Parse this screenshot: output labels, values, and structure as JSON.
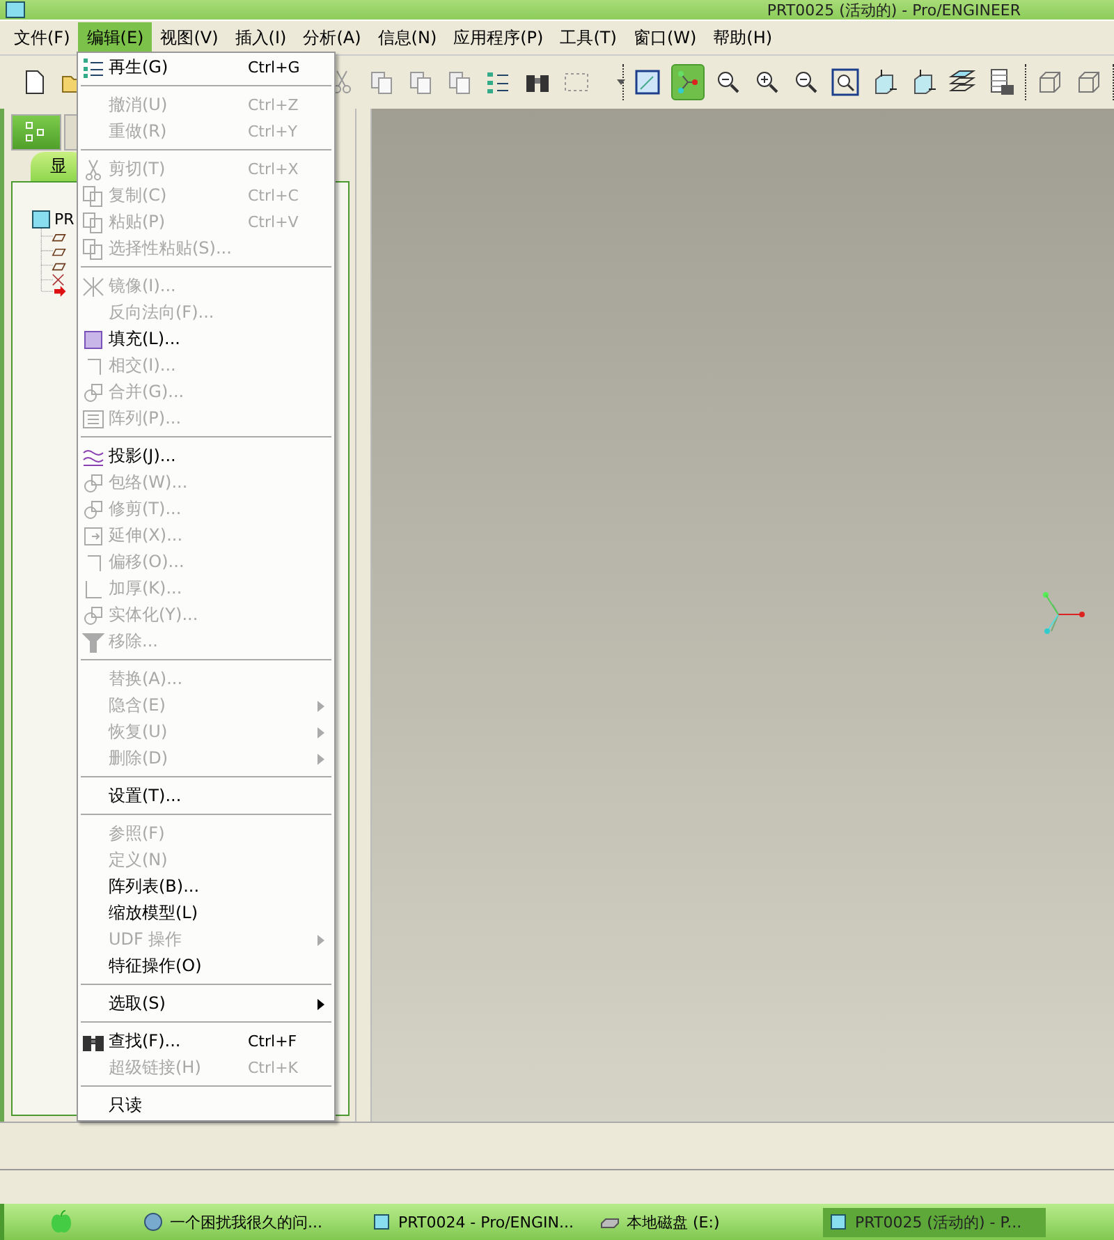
{
  "window": {
    "title": "PRT0025 (活动的) - Pro/ENGINEER"
  },
  "menubar": [
    {
      "label": "文件(F)",
      "selected": false
    },
    {
      "label": "编辑(E)",
      "selected": true
    },
    {
      "label": "视图(V)",
      "selected": false
    },
    {
      "label": "插入(I)",
      "selected": false
    },
    {
      "label": "分析(A)",
      "selected": false
    },
    {
      "label": "信息(N)",
      "selected": false
    },
    {
      "label": "应用程序(P)",
      "selected": false
    },
    {
      "label": "工具(T)",
      "selected": false
    },
    {
      "label": "窗口(W)",
      "selected": false
    },
    {
      "label": "帮助(H)",
      "selected": false
    }
  ],
  "toolbar": {
    "groups": [
      {
        "buttons": [
          {
            "selected": false
          },
          {
            "selected": false
          }
        ]
      },
      {
        "buttons": [
          {
            "selected": false
          },
          {
            "selected": false
          },
          {
            "selected": false
          },
          {
            "selected": false
          },
          {
            "selected": false
          },
          {
            "selected": false
          },
          {
            "selected": false
          }
        ]
      },
      {
        "buttons": [
          {
            "selected": false
          },
          {
            "selected": true
          },
          {
            "selected": false
          },
          {
            "selected": false
          },
          {
            "selected": false
          },
          {
            "selected": false
          },
          {
            "selected": false
          },
          {
            "selected": false
          },
          {
            "selected": false
          },
          {
            "selected": false
          }
        ]
      },
      {
        "buttons": [
          {
            "selected": false
          },
          {
            "selected": false
          }
        ]
      }
    ]
  },
  "sidebar": {
    "tabs": [
      {
        "selected": true
      },
      {
        "selected": false
      }
    ],
    "panel_tab": "显",
    "tree_root": "PR"
  },
  "edit_menu": [
    {
      "kind": "item",
      "label": "再生(G)",
      "shortcut": "Ctrl+G",
      "disabled": false
    },
    {
      "kind": "separator"
    },
    {
      "kind": "item",
      "label": "撤消(U)",
      "shortcut": "Ctrl+Z",
      "disabled": true
    },
    {
      "kind": "item",
      "label": "重做(R)",
      "shortcut": "Ctrl+Y",
      "disabled": true
    },
    {
      "kind": "separator"
    },
    {
      "kind": "item",
      "label": "剪切(T)",
      "shortcut": "Ctrl+X",
      "disabled": true
    },
    {
      "kind": "item",
      "label": "复制(C)",
      "shortcut": "Ctrl+C",
      "disabled": true
    },
    {
      "kind": "item",
      "label": "粘贴(P)",
      "shortcut": "Ctrl+V",
      "disabled": true
    },
    {
      "kind": "item",
      "label": "选择性粘贴(S)...",
      "disabled": true
    },
    {
      "kind": "separator"
    },
    {
      "kind": "item",
      "label": "镜像(I)...",
      "disabled": true
    },
    {
      "kind": "item",
      "label": "反向法向(F)...",
      "disabled": true
    },
    {
      "kind": "item",
      "label": "填充(L)...",
      "disabled": false
    },
    {
      "kind": "item",
      "label": "相交(I)...",
      "disabled": true
    },
    {
      "kind": "item",
      "label": "合并(G)...",
      "disabled": true
    },
    {
      "kind": "item",
      "label": "阵列(P)...",
      "disabled": true
    },
    {
      "kind": "separator"
    },
    {
      "kind": "item",
      "label": "投影(J)...",
      "disabled": false
    },
    {
      "kind": "item",
      "label": "包络(W)...",
      "disabled": true
    },
    {
      "kind": "item",
      "label": "修剪(T)...",
      "disabled": true
    },
    {
      "kind": "item",
      "label": "延伸(X)...",
      "disabled": true
    },
    {
      "kind": "item",
      "label": "偏移(O)...",
      "disabled": true
    },
    {
      "kind": "item",
      "label": "加厚(K)...",
      "disabled": true
    },
    {
      "kind": "item",
      "label": "实体化(Y)...",
      "disabled": true
    },
    {
      "kind": "item",
      "label": "移除...",
      "disabled": true
    },
    {
      "kind": "separator"
    },
    {
      "kind": "item",
      "label": "替换(A)...",
      "disabled": true
    },
    {
      "kind": "submenu",
      "label": "隐含(E)",
      "disabled": true
    },
    {
      "kind": "submenu",
      "label": "恢复(U)",
      "disabled": true
    },
    {
      "kind": "submenu",
      "label": "删除(D)",
      "disabled": true
    },
    {
      "kind": "separator"
    },
    {
      "kind": "item",
      "label": "设置(T)...",
      "disabled": false
    },
    {
      "kind": "separator"
    },
    {
      "kind": "item",
      "label": "参照(F)",
      "disabled": true
    },
    {
      "kind": "item",
      "label": "定义(N)",
      "disabled": true
    },
    {
      "kind": "item",
      "label": "阵列表(B)...",
      "disabled": false
    },
    {
      "kind": "item",
      "label": "缩放模型(L)",
      "disabled": false
    },
    {
      "kind": "submenu",
      "label": "UDF 操作",
      "disabled": true
    },
    {
      "kind": "item",
      "label": "特征操作(O)",
      "disabled": false
    },
    {
      "kind": "separator"
    },
    {
      "kind": "submenu",
      "label": "选取(S)",
      "disabled": false
    },
    {
      "kind": "separator"
    },
    {
      "kind": "item",
      "label": "查找(F)...",
      "shortcut": "Ctrl+F",
      "disabled": false
    },
    {
      "kind": "item",
      "label": "超级链接(H)",
      "shortcut": "Ctrl+K",
      "disabled": true
    },
    {
      "kind": "separator"
    },
    {
      "kind": "item",
      "label": "只读",
      "disabled": false
    }
  ],
  "taskbar": [
    {
      "label": "一个困扰我很久的问...",
      "selected": false
    },
    {
      "label": "PRT0024 - Pro/ENGIN...",
      "selected": false
    },
    {
      "label": "本地磁盘 (E:)",
      "selected": false
    },
    {
      "label": "PRT0025 (活动的) - P...",
      "selected": true
    }
  ]
}
